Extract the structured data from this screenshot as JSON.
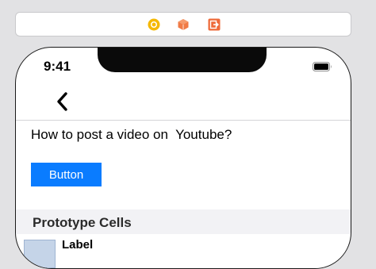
{
  "scene_dock": {
    "icons": [
      "first-responder-icon",
      "object-cube-icon",
      "exit-icon"
    ],
    "colors": {
      "first_responder": "#f5b800",
      "object": "#f07a45",
      "exit": "#ee6a3a"
    }
  },
  "status_bar": {
    "time": "9:41"
  },
  "nav_bar": {
    "back_icon": "chevron-left-icon"
  },
  "content": {
    "question_text": "How to post a video on  Youtube?",
    "button_label": "Button",
    "button_color": "#0a7cff"
  },
  "table": {
    "section_header": "Prototype Cells",
    "cells": [
      {
        "title": "Label"
      }
    ]
  }
}
